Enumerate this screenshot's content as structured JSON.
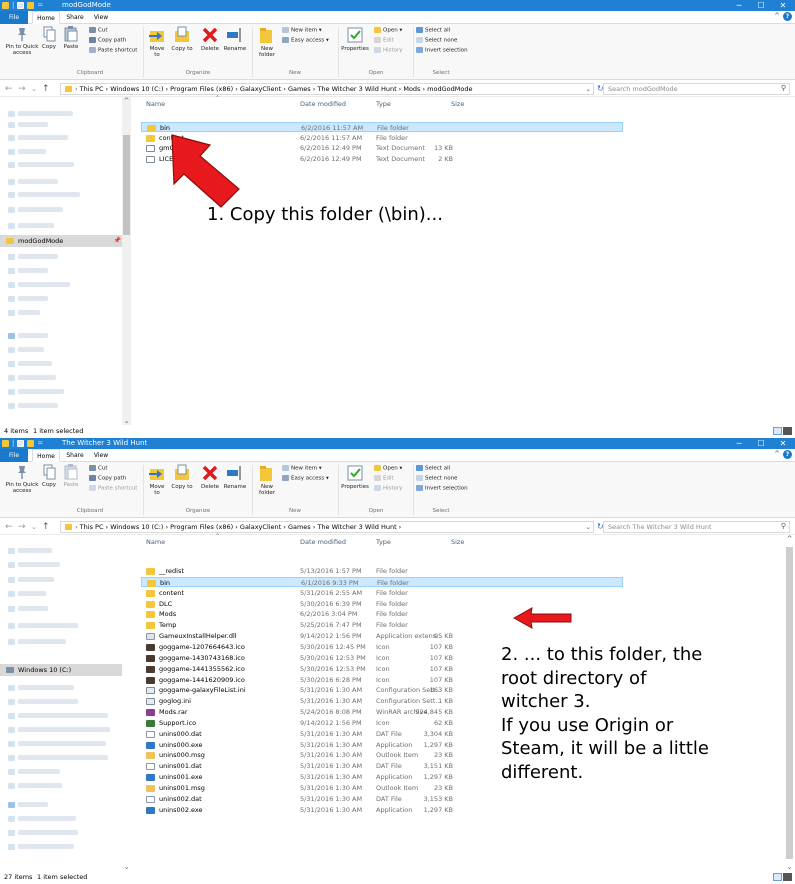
{
  "windows": [
    {
      "title": "modGodMode",
      "tabs": {
        "file": "File",
        "home": "Home",
        "share": "Share",
        "view": "View"
      },
      "ribbon": {
        "pin": "Pin to Quick access",
        "copy": "Copy",
        "paste": "Paste",
        "cut": "Cut",
        "copy_path": "Copy path",
        "paste_shortcut": "Paste shortcut",
        "move_to": "Move to",
        "copy_to": "Copy to",
        "delete": "Delete",
        "rename": "Rename",
        "new_folder": "New folder",
        "new_item": "New item",
        "easy_access": "Easy access",
        "properties": "Properties",
        "open": "Open",
        "edit": "Edit",
        "history": "History",
        "select_all": "Select all",
        "select_none": "Select none",
        "invert_selection": "Invert selection",
        "groups": {
          "clipboard": "Clipboard",
          "organize": "Organize",
          "new": "New",
          "open": "Open",
          "select": "Select"
        }
      },
      "address": {
        "path": "This PC  ›  Windows 10 (C:)  ›  Program Files (x86)  ›  GalaxyClient  ›  Games  ›  The Witcher 3 Wild Hunt  ›  Mods  ›  modGodMode",
        "search_placeholder": "Search modGodMode"
      },
      "nav_selected": "modGodMode",
      "columns": {
        "name": "Name",
        "date": "Date modified",
        "type": "Type",
        "size": "Size"
      },
      "files": [
        {
          "name": "bin",
          "date": "6/2/2016 11:57 AM",
          "type": "File folder",
          "size": "",
          "icon": "folder-icon",
          "selected": true
        },
        {
          "name": "content",
          "date": "6/2/2016 11:57 AM",
          "type": "File folder",
          "size": "",
          "icon": "folder-icon",
          "selected": false
        },
        {
          "name": "gmConfig",
          "date": "6/2/2016 12:49 PM",
          "type": "Text Document",
          "size": "13 KB",
          "icon": "text-document-icon",
          "selected": false
        },
        {
          "name": "LICENSE.txt",
          "date": "6/2/2016 12:49 PM",
          "type": "Text Document",
          "size": "2 KB",
          "icon": "text-document-icon",
          "selected": false
        }
      ],
      "status": {
        "count": "4 items",
        "selection": "1 item selected"
      },
      "annotation": "1. Copy this folder (\\bin)..."
    },
    {
      "title": "The Witcher 3 Wild Hunt",
      "tabs": {
        "file": "File",
        "home": "Home",
        "share": "Share",
        "view": "View"
      },
      "ribbon": {
        "pin": "Pin to Quick access",
        "copy": "Copy",
        "paste": "Paste",
        "cut": "Cut",
        "copy_path": "Copy path",
        "paste_shortcut": "Paste shortcut",
        "move_to": "Move to",
        "copy_to": "Copy to",
        "delete": "Delete",
        "rename": "Rename",
        "new_folder": "New folder",
        "new_item": "New item",
        "easy_access": "Easy access",
        "properties": "Properties",
        "open": "Open",
        "edit": "Edit",
        "history": "History",
        "select_all": "Select all",
        "select_none": "Select none",
        "invert_selection": "Invert selection",
        "groups": {
          "clipboard": "Clipboard",
          "organize": "Organize",
          "new": "New",
          "open": "Open",
          "select": "Select"
        }
      },
      "address": {
        "path": "This PC  ›  Windows 10 (C:)  ›  Program Files (x86)  ›  GalaxyClient  ›  Games  ›  The Witcher 3 Wild Hunt  ›",
        "search_placeholder": "Search The Witcher 3 Wild Hunt"
      },
      "nav_selected": "Windows 10 (C:)",
      "columns": {
        "name": "Name",
        "date": "Date modified",
        "type": "Type",
        "size": "Size"
      },
      "files": [
        {
          "name": "__redist",
          "date": "5/13/2016 1:57 PM",
          "type": "File folder",
          "size": "",
          "icon": "folder-icon",
          "selected": false
        },
        {
          "name": "bin",
          "date": "6/1/2016 9:33 PM",
          "type": "File folder",
          "size": "",
          "icon": "folder-icon",
          "selected": true
        },
        {
          "name": "content",
          "date": "5/31/2016 2:55 AM",
          "type": "File folder",
          "size": "",
          "icon": "folder-icon",
          "selected": false
        },
        {
          "name": "DLC",
          "date": "5/30/2016 6:39 PM",
          "type": "File folder",
          "size": "",
          "icon": "folder-icon",
          "selected": false
        },
        {
          "name": "Mods",
          "date": "6/2/2016 3:04 PM",
          "type": "File folder",
          "size": "",
          "icon": "folder-icon",
          "selected": false
        },
        {
          "name": "Temp",
          "date": "5/25/2016 7:47 PM",
          "type": "File folder",
          "size": "",
          "icon": "folder-icon",
          "selected": false
        },
        {
          "name": "GameuxInstallHelper.dll",
          "date": "9/14/2012 1:56 PM",
          "type": "Application extens...",
          "size": "95 KB",
          "icon": "dll-icon",
          "selected": false
        },
        {
          "name": "goggame-1207664643.ico",
          "date": "5/30/2016 12:45 PM",
          "type": "Icon",
          "size": "107 KB",
          "icon": "gog-icon",
          "selected": false
        },
        {
          "name": "goggame-1430743168.ico",
          "date": "5/30/2016 12:53 PM",
          "type": "Icon",
          "size": "107 KB",
          "icon": "gog-icon",
          "selected": false
        },
        {
          "name": "goggame-1441355562.ico",
          "date": "5/30/2016 12:53 PM",
          "type": "Icon",
          "size": "107 KB",
          "icon": "gog-icon",
          "selected": false
        },
        {
          "name": "goggame-1441620909.ico",
          "date": "5/30/2016 6:28 PM",
          "type": "Icon",
          "size": "107 KB",
          "icon": "gog-icon",
          "selected": false
        },
        {
          "name": "goggame-galaxyFileList.ini",
          "date": "5/31/2016 1:30 AM",
          "type": "Configuration Sett...",
          "size": "163 KB",
          "icon": "config-file-icon",
          "selected": false
        },
        {
          "name": "goglog.ini",
          "date": "5/31/2016 1:30 AM",
          "type": "Configuration Sett...",
          "size": "1 KB",
          "icon": "config-file-icon",
          "selected": false
        },
        {
          "name": "Mods.rar",
          "date": "5/24/2016 8:08 PM",
          "type": "WinRAR archive",
          "size": "924,845 KB",
          "icon": "winrar-icon",
          "selected": false
        },
        {
          "name": "Support.ico",
          "date": "9/14/2012 1:56 PM",
          "type": "Icon",
          "size": "62 KB",
          "icon": "support-icon",
          "selected": false
        },
        {
          "name": "unins000.dat",
          "date": "5/31/2016 1:30 AM",
          "type": "DAT File",
          "size": "3,304 KB",
          "icon": "dat-file-icon",
          "selected": false
        },
        {
          "name": "unins000.exe",
          "date": "5/31/2016 1:30 AM",
          "type": "Application",
          "size": "1,297 KB",
          "icon": "exe-icon",
          "selected": false
        },
        {
          "name": "unins000.msg",
          "date": "5/31/2016 1:30 AM",
          "type": "Outlook Item",
          "size": "23 KB",
          "icon": "msg-icon",
          "selected": false
        },
        {
          "name": "unins001.dat",
          "date": "5/31/2016 1:30 AM",
          "type": "DAT File",
          "size": "3,151 KB",
          "icon": "dat-file-icon",
          "selected": false
        },
        {
          "name": "unins001.exe",
          "date": "5/31/2016 1:30 AM",
          "type": "Application",
          "size": "1,297 KB",
          "icon": "exe-icon",
          "selected": false
        },
        {
          "name": "unins001.msg",
          "date": "5/31/2016 1:30 AM",
          "type": "Outlook Item",
          "size": "23 KB",
          "icon": "msg-icon",
          "selected": false
        },
        {
          "name": "unins002.dat",
          "date": "5/31/2016 1:30 AM",
          "type": "DAT File",
          "size": "3,153 KB",
          "icon": "dat-file-icon",
          "selected": false
        },
        {
          "name": "unins002.exe",
          "date": "5/31/2016 1:30 AM",
          "type": "Application",
          "size": "1,297 KB",
          "icon": "exe-icon",
          "selected": false
        }
      ],
      "status": {
        "count": "27 items",
        "selection": "1 item selected"
      },
      "annotation_lines": [
        "2. ... to this folder, the",
        "root directory of",
        "witcher 3.",
        "If you use Origin or",
        "Steam, it will be a little",
        "different."
      ]
    }
  ],
  "colors": {
    "titlebar": "#1f80d4",
    "file_tab": "#1979ca",
    "selection": "#cce8ff",
    "folder": "#f3c63c",
    "annotation_arrow": "#e8191c"
  }
}
